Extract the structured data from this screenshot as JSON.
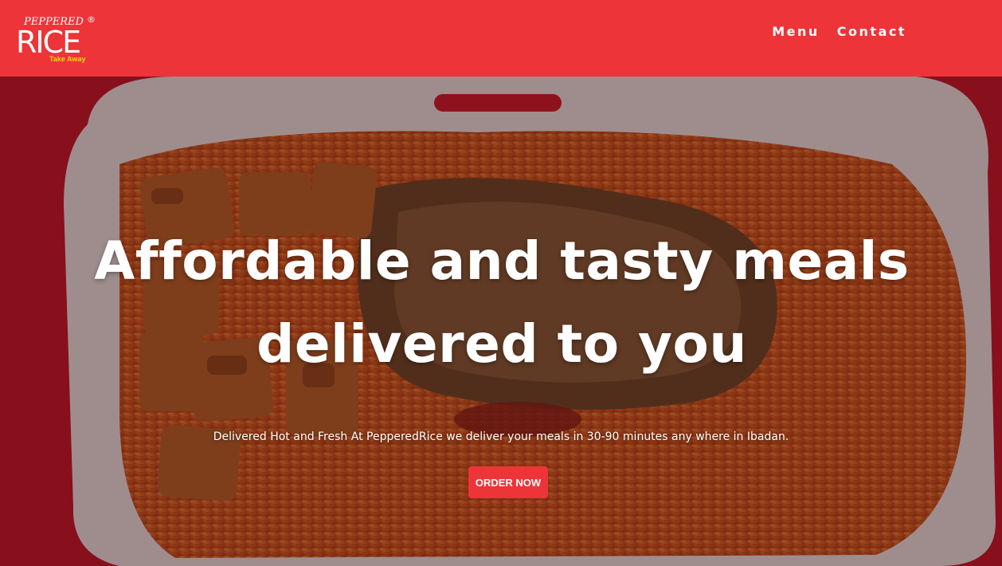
{
  "colors": {
    "header_bg": "#ed3439",
    "brand_yellow": "#f5d90a",
    "button_bg": "#ed3439",
    "text_light": "#ffffff"
  },
  "brand": {
    "top_text": "PEPPERED",
    "main_text": "RICE",
    "tagline": "Take Away",
    "registered_mark": "®"
  },
  "nav": {
    "items": [
      {
        "label": "Menu"
      },
      {
        "label": "Contact"
      }
    ]
  },
  "hero": {
    "image_description": "jollof rice with fried fish and plantain in a white takeaway pack",
    "title": "Affordable and tasty meals delivered to you",
    "subtitle": "Delivered Hot and Fresh At PepperedRice we deliver your meals in 30-90 minutes any where in Ibadan.",
    "cta_label": "ORDER NOW"
  }
}
